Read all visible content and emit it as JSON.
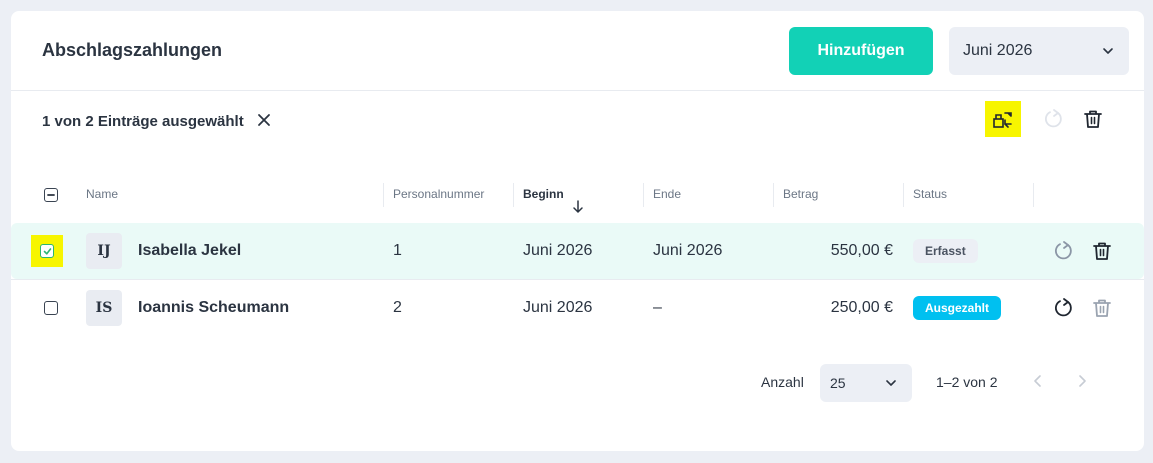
{
  "header": {
    "title": "Abschlagszahlungen",
    "add_label": "Hinzufügen",
    "month_value": "Juni 2026"
  },
  "selection": {
    "text": "1 von 2 Einträge ausgewählt"
  },
  "icons": {
    "close": "close-icon",
    "transfer": "transfer-icon",
    "reset": "reset-icon",
    "trash": "trash-icon",
    "sort": "arrow-down-icon",
    "chevron": "chevron-down-icon"
  },
  "table": {
    "columns": {
      "name": "Name",
      "personalnummer": "Personalnummer",
      "beginn": "Beginn",
      "ende": "Ende",
      "betrag": "Betrag",
      "status": "Status"
    },
    "rows": [
      {
        "initials": "IJ",
        "name": "Isabella Jekel",
        "personalnummer": "1",
        "beginn": "Juni 2026",
        "ende": "Juni 2026",
        "betrag": "550,00 €",
        "status": "Erfasst",
        "selected": true
      },
      {
        "initials": "IS",
        "name": "Ioannis Scheumann",
        "personalnummer": "2",
        "beginn": "Juni 2026",
        "ende": "–",
        "betrag": "250,00 €",
        "status": "Ausgezahlt",
        "selected": false
      }
    ]
  },
  "pagination": {
    "label": "Anzahl",
    "page_size": "25",
    "range": "1–2 von 2"
  },
  "colors": {
    "accent": "#12d1b6",
    "status_erfasst_bg": "#eceff5",
    "status_ausgezahlt_bg": "#00c0f0",
    "highlight": "#f7f500",
    "selected_row": "#eafaf7"
  }
}
